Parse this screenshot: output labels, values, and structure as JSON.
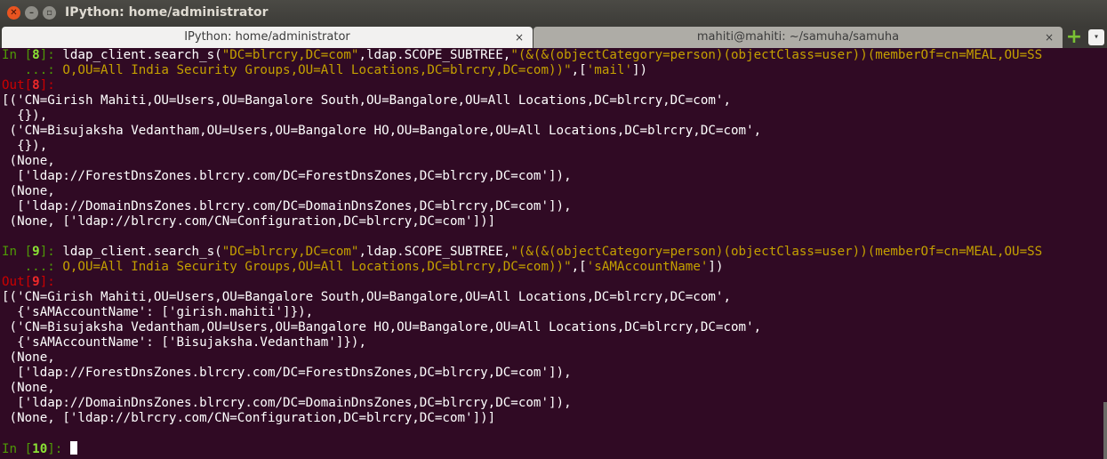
{
  "window": {
    "title": "IPython: home/administrator"
  },
  "tabs": [
    {
      "label": "IPython: home/administrator",
      "close": "×"
    },
    {
      "label": "mahiti@mahiti: ~/samuha/samuha",
      "close": "×"
    }
  ],
  "icons": {
    "new_tab": "+",
    "tab_menu": "▾",
    "close": "✕",
    "minimize": "–",
    "maximize": "▫"
  },
  "colors": {
    "background": "#300a24",
    "prompt_in": "#4e9a06",
    "prompt_out": "#cc0000",
    "string": "#c4a000",
    "accent": "#e95420"
  },
  "terminal": {
    "cell8_in": {
      "prompt": "In [",
      "num": "8",
      "end": "]: ",
      "cont": "   ...: ",
      "p1": "ldap_client.search_s(",
      "s1": "\"DC=blrcry,DC=com\"",
      "p2": ",ldap.SCOPE_SUBTREE,",
      "s2a": "\"(&(&(objectCategory=person)(objectClass=user))(memberOf=cn=MEAL,OU=SS",
      "s2b": "O,OU=All India Security Groups,OU=All Locations,DC=blrcry,DC=com))\"",
      "p3": ",[",
      "s3": "'mail'",
      "p4": "])"
    },
    "cell8_out": {
      "prompt": "Out[",
      "num": "8",
      "end": "]: ",
      "lines": [
        "[('CN=Girish Mahiti,OU=Users,OU=Bangalore South,OU=Bangalore,OU=All Locations,DC=blrcry,DC=com',",
        "  {}),",
        " ('CN=Bisujaksha Vedantham,OU=Users,OU=Bangalore HO,OU=Bangalore,OU=All Locations,DC=blrcry,DC=com',",
        "  {}),",
        " (None,",
        "  ['ldap://ForestDnsZones.blrcry.com/DC=ForestDnsZones,DC=blrcry,DC=com']),",
        " (None,",
        "  ['ldap://DomainDnsZones.blrcry.com/DC=DomainDnsZones,DC=blrcry,DC=com']),",
        " (None, ['ldap://blrcry.com/CN=Configuration,DC=blrcry,DC=com'])]"
      ]
    },
    "cell9_in": {
      "prompt": "In [",
      "num": "9",
      "end": "]: ",
      "cont": "   ...: ",
      "p1": "ldap_client.search_s(",
      "s1": "\"DC=blrcry,DC=com\"",
      "p2": ",ldap.SCOPE_SUBTREE,",
      "s2a": "\"(&(&(objectCategory=person)(objectClass=user))(memberOf=cn=MEAL,OU=SS",
      "s2b": "O,OU=All India Security Groups,OU=All Locations,DC=blrcry,DC=com))\"",
      "p3": ",[",
      "s3": "'sAMAccountName'",
      "p4": "])"
    },
    "cell9_out": {
      "prompt": "Out[",
      "num": "9",
      "end": "]: ",
      "lines": [
        "[('CN=Girish Mahiti,OU=Users,OU=Bangalore South,OU=Bangalore,OU=All Locations,DC=blrcry,DC=com',",
        "  {'sAMAccountName': ['girish.mahiti']}),",
        " ('CN=Bisujaksha Vedantham,OU=Users,OU=Bangalore HO,OU=Bangalore,OU=All Locations,DC=blrcry,DC=com',",
        "  {'sAMAccountName': ['Bisujaksha.Vedantham']}),",
        " (None,",
        "  ['ldap://ForestDnsZones.blrcry.com/DC=ForestDnsZones,DC=blrcry,DC=com']),",
        " (None,",
        "  ['ldap://DomainDnsZones.blrcry.com/DC=DomainDnsZones,DC=blrcry,DC=com']),",
        " (None, ['ldap://blrcry.com/CN=Configuration,DC=blrcry,DC=com'])]"
      ]
    },
    "cell10_in": {
      "prompt": "In [",
      "num": "10",
      "end": "]: "
    }
  }
}
